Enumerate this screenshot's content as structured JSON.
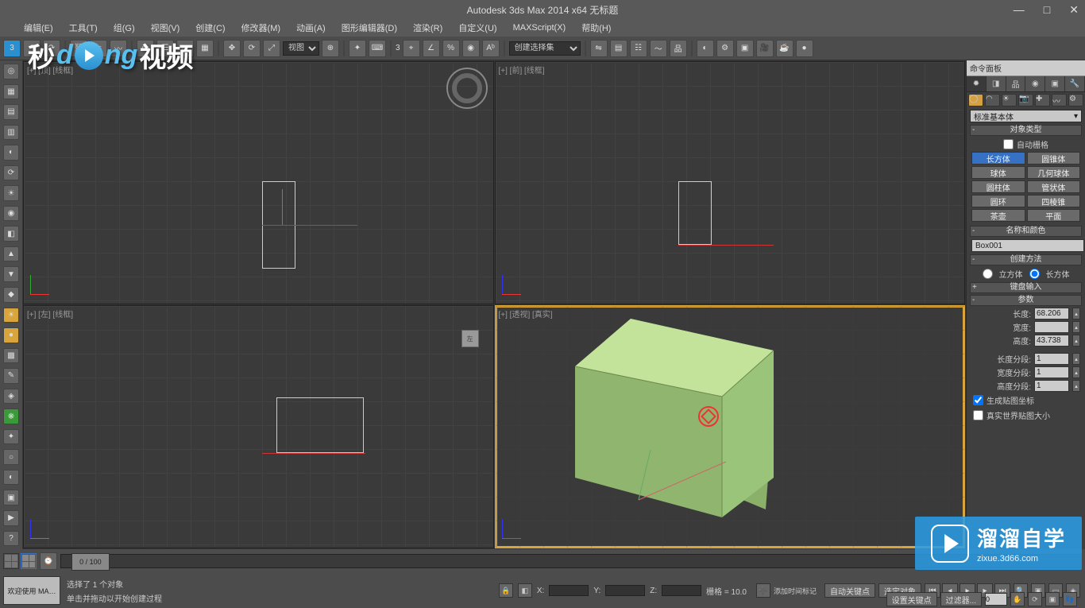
{
  "window": {
    "title": "Autodesk 3ds Max  2014 x64    无标题"
  },
  "winctl": {
    "min": "—",
    "max": "□",
    "close": "✕"
  },
  "menu": [
    "编辑(E)",
    "工具(T)",
    "组(G)",
    "视图(V)",
    "创建(C)",
    "修改器(M)",
    "动画(A)",
    "图形编辑器(D)",
    "渲染(R)",
    "自定义(U)",
    "MAXScript(X)",
    "帮助(H)"
  ],
  "toolbar": {
    "sel1": "视图",
    "sel2": "创建选择集",
    "num": "3"
  },
  "commandPanel": {
    "title": "命令面板",
    "dropdown": "标准基本体",
    "rollObjectType": "对象类型",
    "autoGrid": "自动栅格",
    "prims": [
      "长方体",
      "圆锥体",
      "球体",
      "几何球体",
      "圆柱体",
      "管状体",
      "圆环",
      "四棱锥",
      "茶壶",
      "平面"
    ],
    "rollNameColor": "名称和颜色",
    "objName": "Box001",
    "rollCreateMethod": "创建方法",
    "radCube": "立方体",
    "radBox": "长方体",
    "rollKeyboard": "键盘输入",
    "rollParams": "参数",
    "paramLen": "长度:",
    "paramLenV": "68.206",
    "paramWid": "宽度:",
    "paramWidV": "",
    "paramHei": "高度:",
    "paramHeiV": "43.738",
    "paramLSeg": "长度分段:",
    "paramLSegV": "1",
    "paramWSeg": "宽度分段:",
    "paramWSegV": "1",
    "paramHSeg": "高度分段:",
    "paramHSegV": "1",
    "chkGenMap": "生成贴图坐标",
    "chkRealWorld": "真实世界贴图大小"
  },
  "viewports": {
    "vp1": "[+] [顶] [线框]",
    "vp2": "[+] [前] [线框]",
    "vp3": "[+] [左] [线框]",
    "vp4": "[+] [透视] [真实]"
  },
  "timeline": {
    "range": "0 / 100"
  },
  "status": {
    "welcome": "欢迎使用 MA…",
    "sel": "选择了 1 个对象",
    "hint": "单击并拖动以开始创建过程",
    "x": "X:",
    "y": "Y:",
    "z": "Z:",
    "grid": "栅格 = 10.0",
    "autoKey": "自动关键点",
    "setKey": "设置关键点",
    "selFilter": "选定对象",
    "filter": "过滤器...",
    "addTimeTag": "添加时间标记"
  },
  "watermark": {
    "t1": "秒",
    "t2": "d",
    "t3": "ng",
    "t4": "视频"
  },
  "wmbr": {
    "big": "溜溜自学",
    "sm": "zixue.3d66.com"
  }
}
